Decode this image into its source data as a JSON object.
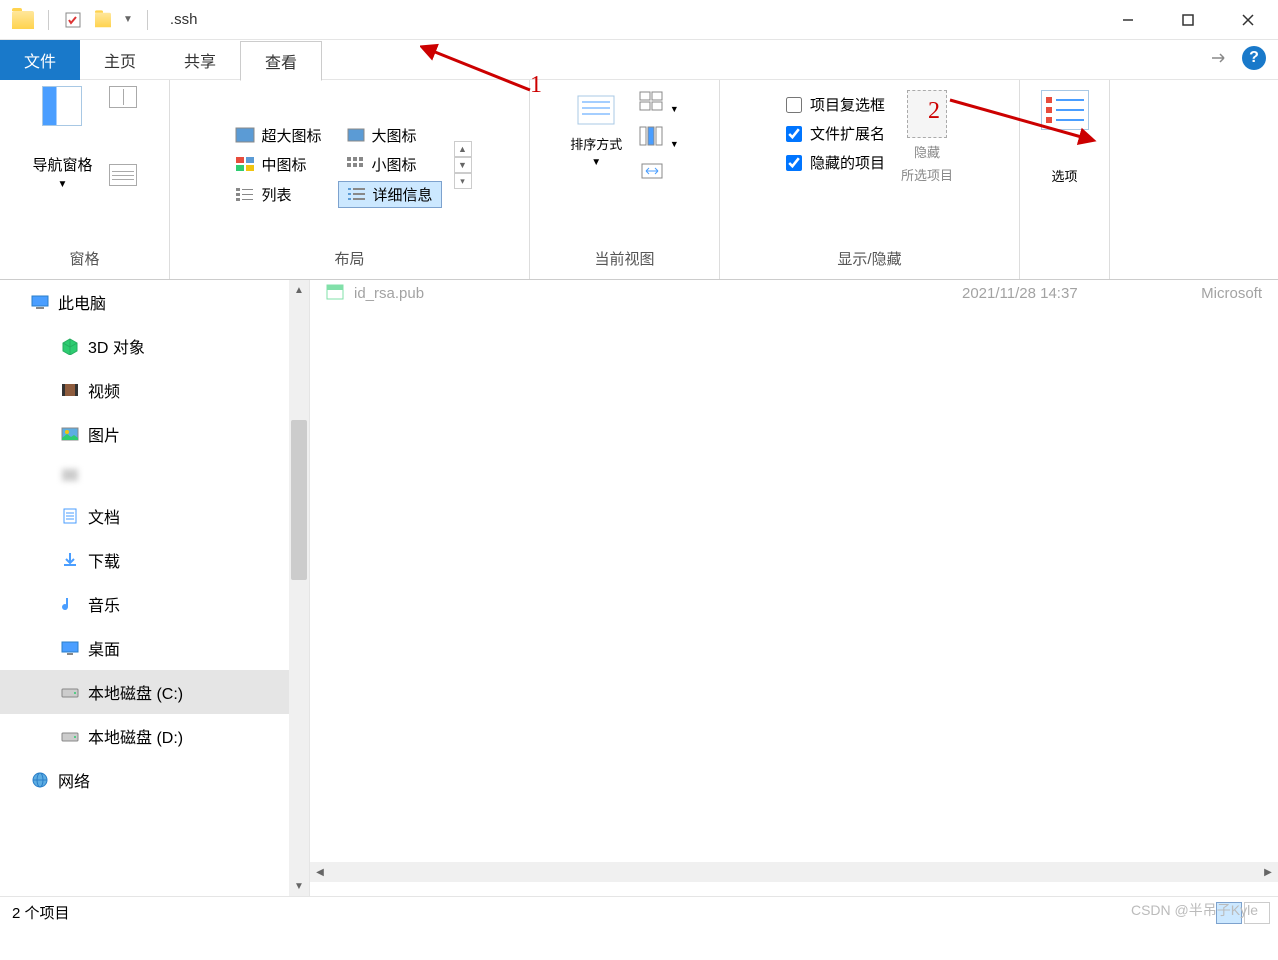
{
  "title": ".ssh",
  "tabs": {
    "file": "文件",
    "home": "主页",
    "share": "共享",
    "view": "查看"
  },
  "ribbon": {
    "panes": {
      "nav": "导航窗格",
      "group": "窗格"
    },
    "layout": {
      "extra_large": "超大图标",
      "large": "大图标",
      "medium": "中图标",
      "small": "小图标",
      "list": "列表",
      "details": "详细信息",
      "group": "布局"
    },
    "current_view": {
      "sort": "排序方式",
      "group": "当前视图"
    },
    "show_hide": {
      "checkboxes": "项目复选框",
      "extensions": "文件扩展名",
      "hidden": "隐藏的项目",
      "hide": "隐藏",
      "hide_selected": "所选项目",
      "group": "显示/隐藏"
    },
    "options": "选项"
  },
  "sidebar": {
    "items": [
      {
        "label": "此电脑",
        "icon": "pc"
      },
      {
        "label": "3D 对象",
        "icon": "3d"
      },
      {
        "label": "视频",
        "icon": "video"
      },
      {
        "label": "图片",
        "icon": "pictures"
      },
      {
        "label": "",
        "icon": "blur",
        "blurred": true
      },
      {
        "label": "文档",
        "icon": "docs"
      },
      {
        "label": "下载",
        "icon": "downloads"
      },
      {
        "label": "音乐",
        "icon": "music"
      },
      {
        "label": "桌面",
        "icon": "desktop"
      },
      {
        "label": "本地磁盘 (C:)",
        "icon": "disk",
        "selected": true
      },
      {
        "label": "本地磁盘 (D:)",
        "icon": "disk"
      },
      {
        "label": "网络",
        "icon": "network"
      }
    ]
  },
  "files": [
    {
      "name": "id_rsa.pub",
      "date": "2021/11/28 14:37",
      "type": "Microsoft"
    }
  ],
  "statusbar": {
    "count": "2 个项目"
  },
  "annotations": {
    "one": "1",
    "two": "2"
  },
  "watermark": "CSDN @半吊子Kyle",
  "checkbox_states": {
    "checkboxes": false,
    "extensions": true,
    "hidden": true
  }
}
